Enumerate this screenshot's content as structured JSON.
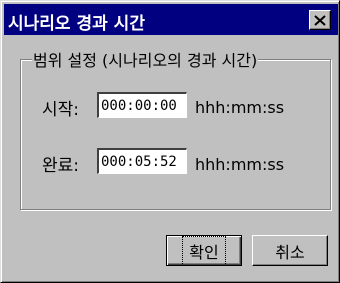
{
  "window": {
    "title": "시나리오 경과 시간",
    "close_symbol": "×"
  },
  "group": {
    "label": "범위 설정 (시나리오의 경과 시간)"
  },
  "start": {
    "label": "시작:",
    "value": "000:00:00",
    "format": "hhh:mm:ss"
  },
  "end": {
    "label": "완료:",
    "value": "000:05:52",
    "format": "hhh:mm:ss"
  },
  "buttons": {
    "ok_label": "확인",
    "cancel_label": "취소"
  },
  "icons": {
    "close": "close-icon"
  },
  "colors": {
    "titlebar": "#000080",
    "face": "#c0c0c0",
    "title_text": "#ffffff"
  }
}
